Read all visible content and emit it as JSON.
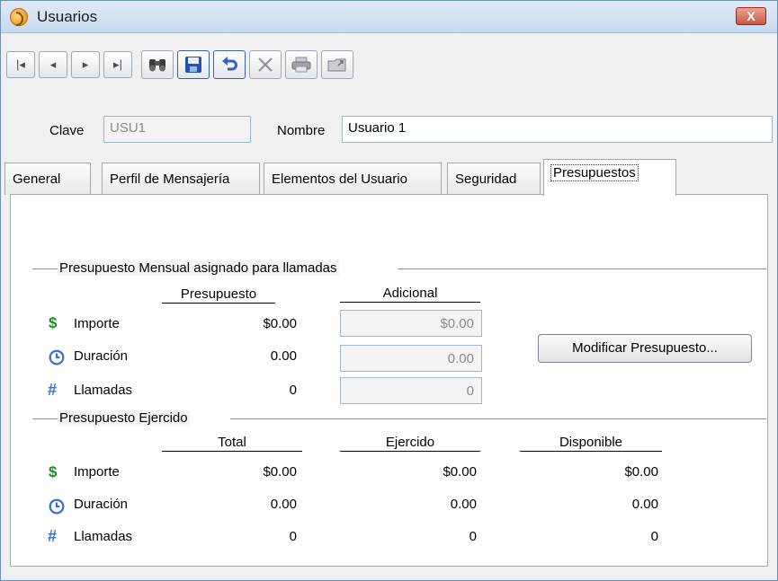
{
  "window": {
    "title": "Usuarios",
    "close_label": "X"
  },
  "toolbar": {
    "first_label": "|◂",
    "prev_label": "◂",
    "next_label": "▸",
    "last_label": "▸|"
  },
  "header": {
    "clave_label": "Clave",
    "clave_value": "USU1",
    "nombre_label": "Nombre",
    "nombre_value": "Usuario 1"
  },
  "tabs": [
    {
      "label": "General"
    },
    {
      "label": "Perfil de Mensajería"
    },
    {
      "label": "Elementos del Usuario"
    },
    {
      "label": "Seguridad"
    },
    {
      "label": "Presupuestos"
    }
  ],
  "monthly": {
    "title": "Presupuesto Mensual asignado para llamadas",
    "col_presupuesto": "Presupuesto",
    "col_adicional": "Adicional",
    "rows": [
      {
        "icon": "dollar-icon",
        "label": "Importe",
        "presupuesto": "$0.00",
        "adicional": "$0.00"
      },
      {
        "icon": "clock-icon",
        "label": "Duración",
        "presupuesto": "0.00",
        "adicional": "0.00"
      },
      {
        "icon": "hash-icon",
        "label": "Llamadas",
        "presupuesto": "0",
        "adicional": "0"
      }
    ],
    "modify_button": "Modificar Presupuesto..."
  },
  "exercised": {
    "title": "Presupuesto Ejercido",
    "col_total": "Total",
    "col_ejercido": "Ejercido",
    "col_disponible": "Disponible",
    "rows": [
      {
        "icon": "dollar-icon",
        "label": "Importe",
        "total": "$0.00",
        "ejercido": "$0.00",
        "disponible": "$0.00"
      },
      {
        "icon": "clock-icon",
        "label": "Duración",
        "total": "0.00",
        "ejercido": "0.00",
        "disponible": "0.00"
      },
      {
        "icon": "hash-icon",
        "label": "Llamadas",
        "total": "0",
        "ejercido": "0",
        "disponible": "0"
      }
    ]
  },
  "colors": {
    "accent": "#3a6fd1",
    "money": "#1f8a2c"
  }
}
